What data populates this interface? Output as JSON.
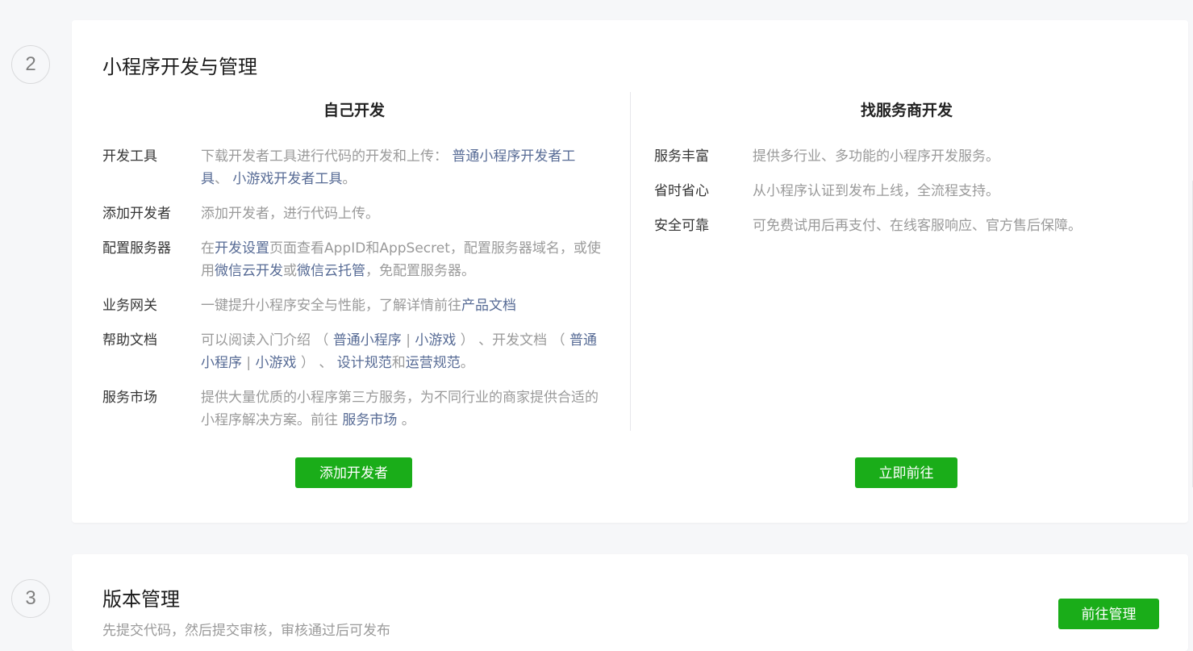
{
  "step2": {
    "number": "2",
    "title": "小程序开发与管理",
    "left": {
      "title": "自己开发",
      "rows": [
        {
          "label": "开发工具",
          "parts": [
            {
              "t": "下载开发者工具进行代码的开发和上传： "
            },
            {
              "t": "普通小程序开发者工具",
              "link": true
            },
            {
              "t": "、 "
            },
            {
              "t": "小游戏开发者工具",
              "link": true
            },
            {
              "t": "。"
            }
          ]
        },
        {
          "label": "添加开发者",
          "parts": [
            {
              "t": "添加开发者，进行代码上传。"
            }
          ]
        },
        {
          "label": "配置服务器",
          "parts": [
            {
              "t": "在"
            },
            {
              "t": "开发设置",
              "link": true
            },
            {
              "t": "页面查看AppID和AppSecret，配置服务器域名，或使用"
            },
            {
              "t": "微信云开发",
              "link": true
            },
            {
              "t": "或"
            },
            {
              "t": "微信云托管",
              "link": true
            },
            {
              "t": "，免配置服务器。"
            }
          ]
        },
        {
          "label": "业务网关",
          "parts": [
            {
              "t": "一键提升小程序安全与性能，了解详情前往"
            },
            {
              "t": "产品文档",
              "link": true
            }
          ]
        },
        {
          "label": "帮助文档",
          "parts": [
            {
              "t": "可以阅读入门介绍 （ "
            },
            {
              "t": "普通小程序",
              "link": true
            },
            {
              "t": " | "
            },
            {
              "t": "小游戏",
              "link": true
            },
            {
              "t": " ） 、开发文档 （ "
            },
            {
              "t": "普通小程序",
              "link": true
            },
            {
              "t": " | "
            },
            {
              "t": "小游戏",
              "link": true
            },
            {
              "t": " ） 、 "
            },
            {
              "t": "设计规范",
              "link": true
            },
            {
              "t": "和"
            },
            {
              "t": "运营规范",
              "link": true
            },
            {
              "t": "。"
            }
          ]
        },
        {
          "label": "服务市场",
          "parts": [
            {
              "t": "提供大量优质的小程序第三方服务，为不同行业的商家提供合适的小程序解决方案。前往 "
            },
            {
              "t": "服务市场",
              "link": true
            },
            {
              "t": " 。"
            }
          ]
        }
      ],
      "button": "添加开发者"
    },
    "right": {
      "title": "找服务商开发",
      "rows": [
        {
          "label": "服务丰富",
          "parts": [
            {
              "t": "提供多行业、多功能的小程序开发服务。"
            }
          ]
        },
        {
          "label": "省时省心",
          "parts": [
            {
              "t": "从小程序认证到发布上线，全流程支持。"
            }
          ]
        },
        {
          "label": "安全可靠",
          "parts": [
            {
              "t": "可免费试用后再支付、在线客服响应、官方售后保障。"
            }
          ]
        }
      ],
      "button": "立即前往"
    }
  },
  "step3": {
    "number": "3",
    "title": "版本管理",
    "description": "先提交代码，然后提交审核，审核通过后可发布",
    "button": "前往管理"
  },
  "colors": {
    "primary_button": "#1aad19",
    "link": "#576b95",
    "muted_text": "#9a9a9a"
  }
}
